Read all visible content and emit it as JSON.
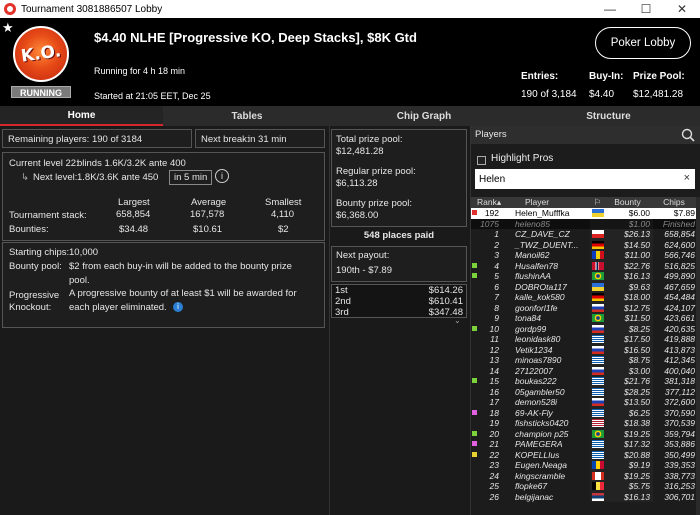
{
  "window": {
    "title": "Tournament 3081886507 Lobby",
    "controls": {
      "minimize": "—",
      "maximize": "☐",
      "close": "✕"
    }
  },
  "header": {
    "badge_text": "K.O.",
    "status": "RUNNING",
    "title": "$4.40 NLHE [Progressive KO, Deep Stacks], $8K Gtd",
    "running_for": "Running for 4 h 18 min",
    "started": "Started at 21:05 EET, Dec 25",
    "lobby_button": "Poker Lobby",
    "entries_label": "Entries:",
    "entries_value": "190 of 3,184",
    "buyin_label": "Buy-In:",
    "buyin_value": "$4.40",
    "prizepool_label": "Prize Pool:",
    "prizepool_value": "$12,481.28"
  },
  "tabs": [
    "Home",
    "Tables",
    "Chip Graph",
    "Structure"
  ],
  "left": {
    "remaining": "Remaining players: 190 of 3184",
    "next_break_label": "Next break:",
    "next_break_value": "in 31 min",
    "current_level": "Current level 22:",
    "current_level_value": "blinds 1.6K/3.2K ante 400",
    "next_level_label": "Next level:",
    "next_level_value": "1.8K/3.6K ante 450",
    "next_level_time": "in 5 min",
    "stack_headers": {
      "largest": "Largest",
      "average": "Average",
      "smallest": "Smallest"
    },
    "tournament_stack_label": "Tournament stack:",
    "tournament_stack": {
      "largest": "658,854",
      "average": "167,578",
      "smallest": "4,110"
    },
    "bounties_label": "Bounties:",
    "bounties": {
      "largest": "$34.48",
      "average": "$10.61",
      "smallest": "$2"
    },
    "starting_chips_label": "Starting chips:",
    "starting_chips_value": "10,000",
    "bounty_pool_label": "Bounty pool:",
    "bounty_pool_line1": "$2 from each buy-in will be added to the bounty prize",
    "bounty_pool_line2": "pool.",
    "progressive_label1": "Progressive",
    "progressive_label2": "Knockout:",
    "progressive_line1": "A progressive bounty of at least $1 will be awarded for",
    "progressive_line2": "each player eliminated."
  },
  "mid": {
    "total_label": "Total prize pool:",
    "total_value": "$12,481.28",
    "regular_label": "Regular prize pool:",
    "regular_value": "$6,113.28",
    "bounty_label": "Bounty prize pool:",
    "bounty_value": "$6,368.00",
    "places_paid": "548 places paid",
    "next_payout_label": "Next payout:",
    "next_payout_value": "190th - $7.89",
    "payouts": [
      {
        "place": "1st",
        "amount": "$614.26"
      },
      {
        "place": "2nd",
        "amount": "$610.41"
      },
      {
        "place": "3rd",
        "amount": "$347.48"
      }
    ]
  },
  "players": {
    "header": "Players",
    "highlight_label": "Highlight Pros",
    "search_value": "Helen",
    "columns": {
      "rank": "Rank",
      "player": "Player",
      "bounty": "Bounty",
      "chips": "Chips"
    },
    "rows": [
      {
        "mark": "#e03030",
        "rank": "192",
        "player": "Helen_Mufffka",
        "flag": "ua",
        "bounty": "$6.00",
        "chips": "$7.89",
        "type": "sel"
      },
      {
        "mark": "",
        "rank": "1075",
        "player": "helenо85",
        "flag": "",
        "bounty": "$1.00",
        "chips": "Finished",
        "type": "fin"
      },
      {
        "mark": "",
        "rank": "1",
        "player": "CZ_DAVE_CZ",
        "flag": "cz",
        "bounty": "$26.13",
        "chips": "658,854",
        "type": ""
      },
      {
        "mark": "",
        "rank": "2",
        "player": "_TWZ_DUENT...",
        "flag": "de",
        "bounty": "$14.50",
        "chips": "624,600",
        "type": ""
      },
      {
        "mark": "",
        "rank": "3",
        "player": "Manoil62",
        "flag": "ro",
        "bounty": "$11.00",
        "chips": "566,746",
        "type": ""
      },
      {
        "mark": "#7cd23a",
        "rank": "4",
        "player": "Husalfen78",
        "flag": "no",
        "bounty": "$22.76",
        "chips": "516,825",
        "type": ""
      },
      {
        "mark": "#7cd23a",
        "rank": "5",
        "player": "flushinAA",
        "flag": "br",
        "bounty": "$16.13",
        "chips": "499,890",
        "type": ""
      },
      {
        "mark": "",
        "rank": "6",
        "player": "DOBROta117",
        "flag": "ua",
        "bounty": "$9.63",
        "chips": "467,659",
        "type": ""
      },
      {
        "mark": "",
        "rank": "7",
        "player": "kalle_kok580",
        "flag": "de",
        "bounty": "$18.00",
        "chips": "454,484",
        "type": ""
      },
      {
        "mark": "",
        "rank": "8",
        "player": "goonforl1fe",
        "flag": "ru",
        "bounty": "$12.75",
        "chips": "424,107",
        "type": ""
      },
      {
        "mark": "",
        "rank": "9",
        "player": "tona84",
        "flag": "br",
        "bounty": "$11.50",
        "chips": "423,661",
        "type": ""
      },
      {
        "mark": "#7cd23a",
        "rank": "10",
        "player": "gordp99",
        "flag": "ru",
        "bounty": "$8.25",
        "chips": "420,635",
        "type": ""
      },
      {
        "mark": "",
        "rank": "11",
        "player": "leonidask80",
        "flag": "gr",
        "bounty": "$17.50",
        "chips": "419,888",
        "type": ""
      },
      {
        "mark": "",
        "rank": "12",
        "player": "Vetik1234",
        "flag": "ru",
        "bounty": "$16.50",
        "chips": "413,873",
        "type": ""
      },
      {
        "mark": "",
        "rank": "13",
        "player": "minoas7890",
        "flag": "gr",
        "bounty": "$8.75",
        "chips": "412,345",
        "type": ""
      },
      {
        "mark": "",
        "rank": "14",
        "player": "27122007",
        "flag": "ru",
        "bounty": "$3.00",
        "chips": "400,040",
        "type": ""
      },
      {
        "mark": "#7cd23a",
        "rank": "15",
        "player": "boukas222",
        "flag": "gr",
        "bounty": "$21.76",
        "chips": "381,318",
        "type": ""
      },
      {
        "mark": "",
        "rank": "16",
        "player": "05gambler50",
        "flag": "gr",
        "bounty": "$28.25",
        "chips": "377,112",
        "type": ""
      },
      {
        "mark": "",
        "rank": "17",
        "player": "demon528i",
        "flag": "ru",
        "bounty": "$13.50",
        "chips": "372,600",
        "type": ""
      },
      {
        "mark": "#e060e0",
        "rank": "18",
        "player": "69-AK-Fly",
        "flag": "gr",
        "bounty": "$6.25",
        "chips": "370,590",
        "type": ""
      },
      {
        "mark": "",
        "rank": "19",
        "player": "fishsticks0420",
        "flag": "us",
        "bounty": "$18.38",
        "chips": "370,539",
        "type": ""
      },
      {
        "mark": "#7cd23a",
        "rank": "20",
        "player": "champion p25",
        "flag": "br",
        "bounty": "$19.25",
        "chips": "359,794",
        "type": ""
      },
      {
        "mark": "#e060e0",
        "rank": "21",
        "player": "PAMEGERA",
        "flag": "gr",
        "bounty": "$17.32",
        "chips": "353,886",
        "type": ""
      },
      {
        "mark": "#e8d030",
        "rank": "22",
        "player": "KOPELLIus",
        "flag": "gr",
        "bounty": "$20.88",
        "chips": "350,499",
        "type": ""
      },
      {
        "mark": "",
        "rank": "23",
        "player": "Eugen.Neaga",
        "flag": "md",
        "bounty": "$9.19",
        "chips": "339,353",
        "type": ""
      },
      {
        "mark": "",
        "rank": "24",
        "player": "kingscramble",
        "flag": "ca",
        "bounty": "$19.25",
        "chips": "338,773",
        "type": ""
      },
      {
        "mark": "",
        "rank": "25",
        "player": "flopke67",
        "flag": "be",
        "bounty": "$5.75",
        "chips": "316,253",
        "type": ""
      },
      {
        "mark": "",
        "rank": "26",
        "player": "belgijanac",
        "flag": "rs",
        "bounty": "$16.13",
        "chips": "306,701",
        "type": ""
      }
    ]
  },
  "colors": {
    "accent": "#d6282c",
    "panel_bg": "#1a1a1a",
    "header_bg": "#000000"
  }
}
